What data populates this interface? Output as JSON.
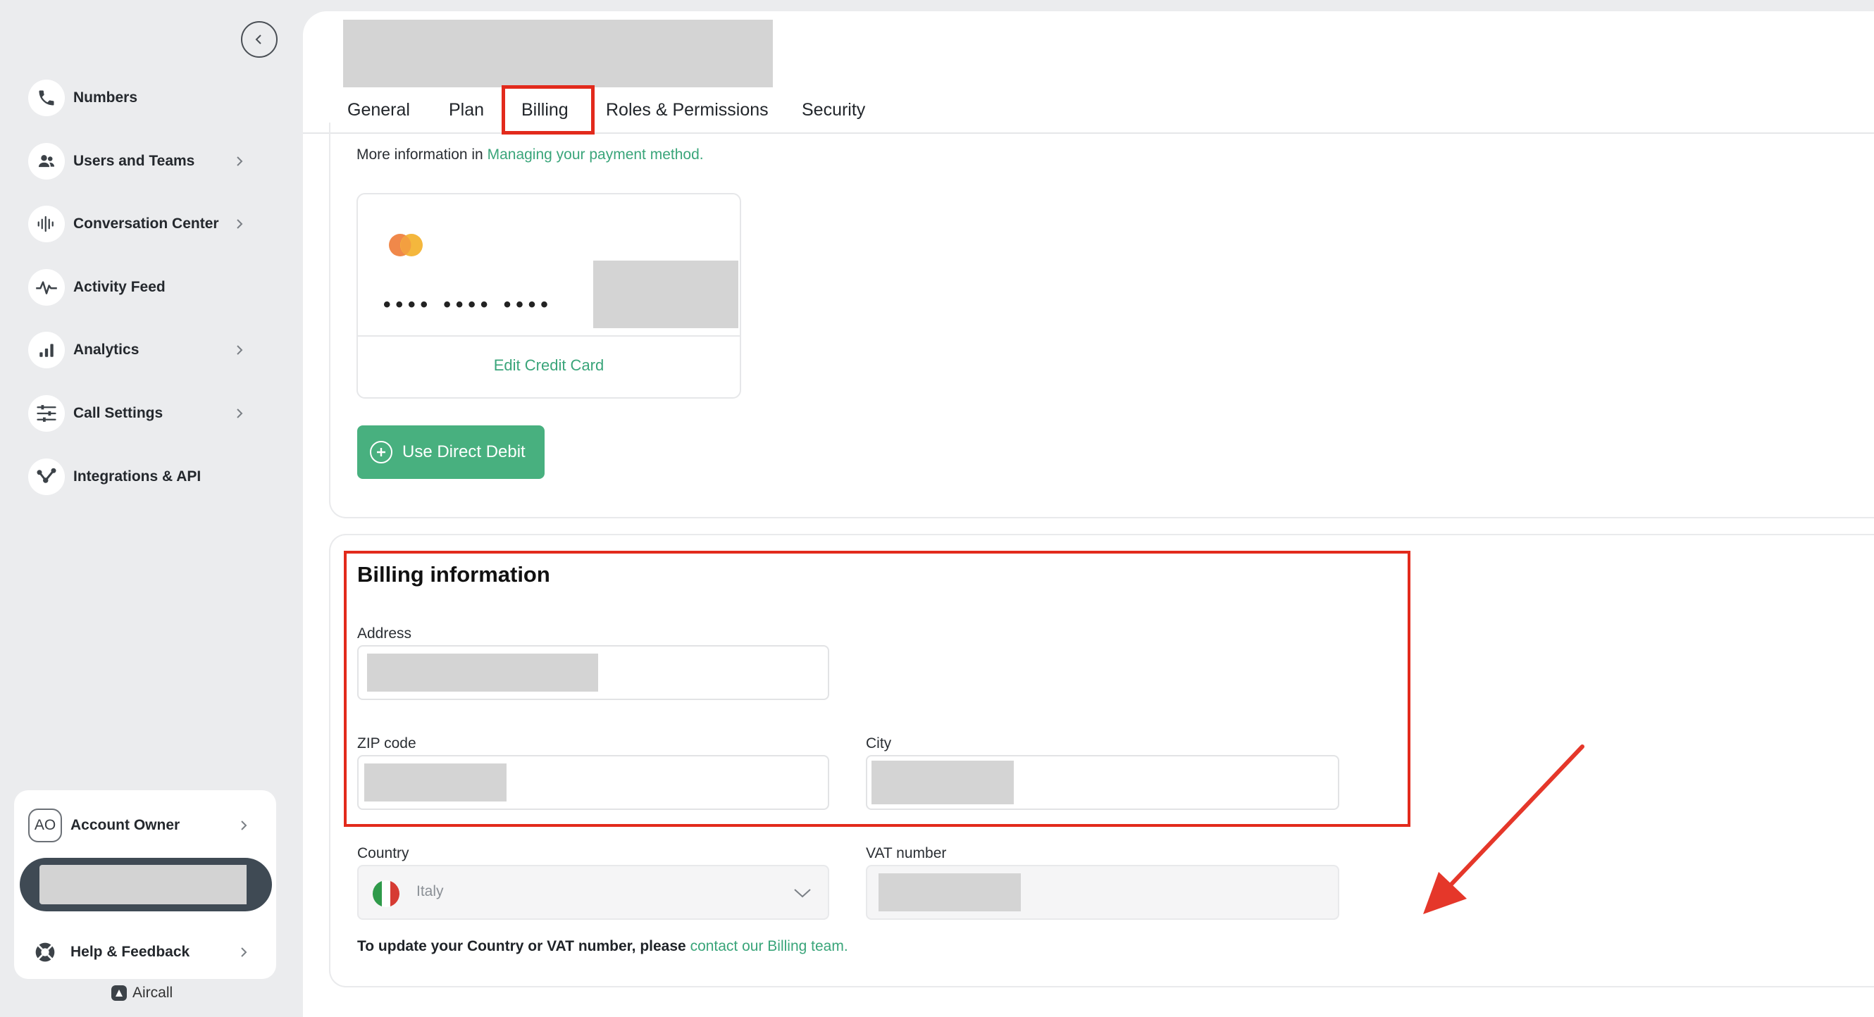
{
  "sidebar": {
    "collapse_icon": "chevron-left-icon",
    "items": [
      {
        "label": "Numbers",
        "icon": "phone-icon",
        "has_submenu": false
      },
      {
        "label": "Users and Teams",
        "icon": "users-icon",
        "has_submenu": true
      },
      {
        "label": "Conversation Center",
        "icon": "waveform-icon",
        "has_submenu": true
      },
      {
        "label": "Activity Feed",
        "icon": "pulse-icon",
        "has_submenu": false
      },
      {
        "label": "Analytics",
        "icon": "bar-chart-icon",
        "has_submenu": true
      },
      {
        "label": "Call Settings",
        "icon": "sliders-icon",
        "has_submenu": true
      },
      {
        "label": "Integrations & API",
        "icon": "integrations-icon",
        "has_submenu": false
      }
    ],
    "account": {
      "initials": "AO",
      "label": "Account Owner"
    },
    "help": {
      "label": "Help & Feedback",
      "icon": "lifebuoy-icon"
    },
    "brand": "Aircall"
  },
  "tabs": [
    "General",
    "Plan",
    "Billing",
    "Roles & Permissions",
    "Security"
  ],
  "active_tab": "Billing",
  "payment": {
    "more_info_prefix": "More information in",
    "more_info_link": "Managing your payment method.",
    "card_brand": "mastercard-icon",
    "masked_number": "•••• •••• ••••",
    "edit_label": "Edit Credit Card",
    "direct_debit_label": "Use Direct Debit"
  },
  "billing": {
    "title": "Billing information",
    "address_label": "Address",
    "zip_label": "ZIP code",
    "city_label": "City",
    "country_label": "Country",
    "country_value": "Italy",
    "vat_label": "VAT number",
    "note_prefix": "To update your Country or VAT number, please",
    "note_link": "contact our Billing team."
  },
  "colors": {
    "accent_green": "#48b07f",
    "link_green": "#3aa57a",
    "annotation_red": "#e22a1c",
    "sidebar_bg": "#ebecee"
  }
}
